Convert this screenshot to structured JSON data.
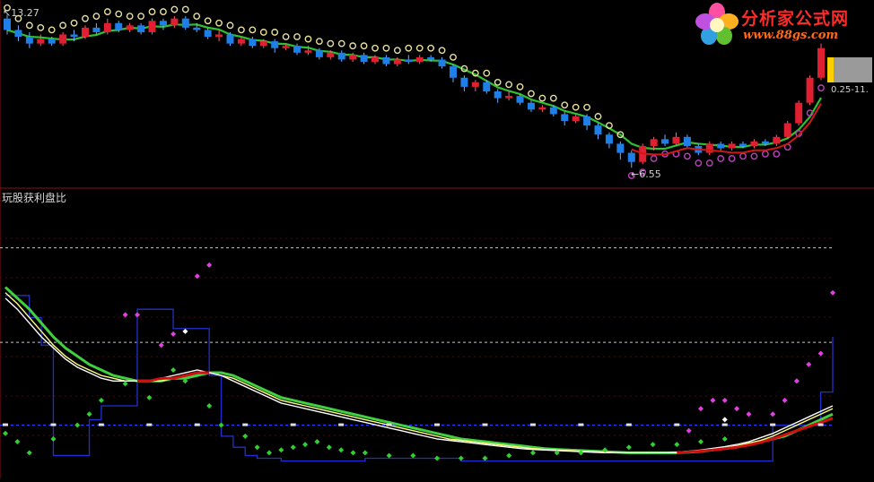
{
  "chart_data": [
    {
      "type": "candlestick",
      "price_high_label": "13.27",
      "price_low_label": "6.55",
      "last_value_label": "0.25-11.",
      "ylim": [
        6.2,
        13.6
      ],
      "candles": [
        [
          13.1,
          12.6,
          13.27,
          12.4
        ],
        [
          12.6,
          12.3,
          12.8,
          12.1
        ],
        [
          12.3,
          12.0,
          12.5,
          11.8
        ],
        [
          12.0,
          12.2,
          12.4,
          11.9
        ],
        [
          12.2,
          12.0,
          12.3,
          11.9
        ],
        [
          12.0,
          12.4,
          12.5,
          11.9
        ],
        [
          12.4,
          12.3,
          12.6,
          12.1
        ],
        [
          12.3,
          12.7,
          12.8,
          12.2
        ],
        [
          12.7,
          12.5,
          12.9,
          12.4
        ],
        [
          12.5,
          12.9,
          13.1,
          12.4
        ],
        [
          12.9,
          12.6,
          13.0,
          12.5
        ],
        [
          12.6,
          12.8,
          12.9,
          12.5
        ],
        [
          12.8,
          12.5,
          12.9,
          12.4
        ],
        [
          12.5,
          13.0,
          13.1,
          12.4
        ],
        [
          13.0,
          12.8,
          13.1,
          12.6
        ],
        [
          12.8,
          13.1,
          13.2,
          12.7
        ],
        [
          13.1,
          12.7,
          13.2,
          12.6
        ],
        [
          12.7,
          12.6,
          12.9,
          12.5
        ],
        [
          12.6,
          12.3,
          12.7,
          12.2
        ],
        [
          12.3,
          12.4,
          12.6,
          12.1
        ],
        [
          12.4,
          12.0,
          12.5,
          11.9
        ],
        [
          12.0,
          12.2,
          12.3,
          11.9
        ],
        [
          12.2,
          11.9,
          12.3,
          11.8
        ],
        [
          11.9,
          12.1,
          12.2,
          11.8
        ],
        [
          12.1,
          11.8,
          12.2,
          11.6
        ],
        [
          11.8,
          11.9,
          12.0,
          11.7
        ],
        [
          11.9,
          11.6,
          12.0,
          11.5
        ],
        [
          11.6,
          11.7,
          11.9,
          11.5
        ],
        [
          11.7,
          11.4,
          11.8,
          11.3
        ],
        [
          11.4,
          11.6,
          11.7,
          11.3
        ],
        [
          11.6,
          11.3,
          11.7,
          11.2
        ],
        [
          11.3,
          11.5,
          11.6,
          11.2
        ],
        [
          11.5,
          11.2,
          11.6,
          11.1
        ],
        [
          11.2,
          11.4,
          11.5,
          11.1
        ],
        [
          11.4,
          11.1,
          11.5,
          11.0
        ],
        [
          11.1,
          11.3,
          11.4,
          11.0
        ],
        [
          11.3,
          11.2,
          11.5,
          11.1
        ],
        [
          11.2,
          11.4,
          11.5,
          11.1
        ],
        [
          11.4,
          11.3,
          11.5,
          11.2
        ],
        [
          11.3,
          11.0,
          11.4,
          10.9
        ],
        [
          11.0,
          10.5,
          11.1,
          10.3
        ],
        [
          10.5,
          10.1,
          10.6,
          9.9
        ],
        [
          10.1,
          10.3,
          10.4,
          9.9
        ],
        [
          10.3,
          9.9,
          10.4,
          9.8
        ],
        [
          9.9,
          9.6,
          10.0,
          9.4
        ],
        [
          9.6,
          9.7,
          9.9,
          9.5
        ],
        [
          9.7,
          9.4,
          9.8,
          9.3
        ],
        [
          9.4,
          9.1,
          9.5,
          9.0
        ],
        [
          9.1,
          9.2,
          9.3,
          9.0
        ],
        [
          9.2,
          8.9,
          9.3,
          8.8
        ],
        [
          8.9,
          8.6,
          9.0,
          8.4
        ],
        [
          8.6,
          8.8,
          8.9,
          8.5
        ],
        [
          8.8,
          8.4,
          8.9,
          8.2
        ],
        [
          8.4,
          8.0,
          8.5,
          7.8
        ],
        [
          8.0,
          7.6,
          8.1,
          7.4
        ],
        [
          7.6,
          7.2,
          7.7,
          6.9
        ],
        [
          7.2,
          6.8,
          7.3,
          6.55
        ],
        [
          6.8,
          7.5,
          7.6,
          6.7
        ],
        [
          7.5,
          7.8,
          7.9,
          7.3
        ],
        [
          7.8,
          7.6,
          8.0,
          7.5
        ],
        [
          7.6,
          7.9,
          8.1,
          7.5
        ],
        [
          7.9,
          7.5,
          8.0,
          7.4
        ],
        [
          7.5,
          7.2,
          7.6,
          7.1
        ],
        [
          7.2,
          7.6,
          7.7,
          7.1
        ],
        [
          7.6,
          7.4,
          7.7,
          7.3
        ],
        [
          7.4,
          7.6,
          7.7,
          7.3
        ],
        [
          7.6,
          7.5,
          7.7,
          7.4
        ],
        [
          7.5,
          7.7,
          7.8,
          7.4
        ],
        [
          7.7,
          7.6,
          7.8,
          7.5
        ],
        [
          7.6,
          7.9,
          8.0,
          7.5
        ],
        [
          7.9,
          8.5,
          8.6,
          7.8
        ],
        [
          8.5,
          9.4,
          9.5,
          8.4
        ],
        [
          9.4,
          10.5,
          10.6,
          9.3
        ],
        [
          10.5,
          11.8,
          12.0,
          10.4
        ]
      ]
    },
    {
      "type": "line",
      "title": "玩股获利盘比",
      "ylim": [
        0,
        100
      ],
      "reference_lines": [
        80,
        48,
        18
      ],
      "series": [
        {
          "color": "#40d040",
          "values": [
            68,
            64,
            60,
            55,
            50,
            46,
            43,
            40,
            38,
            36,
            35,
            34,
            34,
            34,
            35,
            35,
            36,
            37,
            37,
            36,
            34,
            32,
            30,
            28,
            27,
            26,
            25,
            24,
            23,
            22,
            21,
            20,
            19,
            18,
            17,
            16,
            15,
            14,
            13,
            12.5,
            12,
            11.5,
            11,
            10.5,
            10,
            9.5,
            9.2,
            9,
            8.8,
            8.6,
            8.4,
            8.2,
            8,
            8,
            8,
            8,
            8,
            8.2,
            8.5,
            9,
            9.5,
            10,
            11,
            12,
            13,
            14,
            16,
            18,
            20,
            22
          ]
        },
        {
          "color": "#ffff80",
          "values": [
            66,
            62,
            57,
            52,
            47,
            43,
            40,
            38,
            36,
            35,
            34,
            34,
            34,
            34,
            35,
            36,
            37,
            37,
            36,
            35,
            33,
            31,
            29,
            27,
            26,
            25,
            24,
            23,
            22,
            21,
            20,
            19,
            18,
            17,
            16,
            15,
            14,
            13,
            12.5,
            12,
            11.5,
            11,
            10.5,
            10,
            9.5,
            9.2,
            9,
            8.8,
            8.6,
            8.4,
            8.2,
            8,
            8,
            8,
            8,
            8,
            8,
            8.3,
            8.7,
            9.2,
            9.8,
            10.5,
            11.5,
            12.5,
            14,
            16,
            18,
            20,
            22,
            24
          ]
        },
        {
          "color": "#ffffff",
          "values": [
            64,
            60,
            55,
            50,
            46,
            42,
            39,
            37,
            35,
            34,
            34,
            34,
            34,
            35,
            36,
            37,
            38,
            37,
            36,
            34,
            32,
            30,
            28,
            26,
            25,
            24,
            23,
            22,
            21,
            20,
            19,
            18,
            17,
            16,
            15,
            14,
            13,
            12.5,
            12,
            11.5,
            11,
            10.5,
            10,
            9.5,
            9.2,
            9,
            8.8,
            8.6,
            8.4,
            8.2,
            8,
            8,
            8,
            8,
            8,
            8,
            8.2,
            8.6,
            9,
            9.6,
            10.2,
            11,
            12,
            13.5,
            15,
            17,
            19,
            21,
            23,
            25
          ]
        },
        {
          "color": "#d01010",
          "values": [
            null,
            null,
            null,
            null,
            null,
            null,
            null,
            null,
            null,
            null,
            null,
            34,
            34,
            35,
            35,
            36,
            37,
            37,
            null,
            null,
            null,
            null,
            null,
            null,
            null,
            null,
            null,
            null,
            null,
            null,
            null,
            null,
            null,
            null,
            null,
            null,
            null,
            null,
            null,
            null,
            null,
            null,
            null,
            null,
            null,
            null,
            null,
            null,
            null,
            null,
            null,
            null,
            null,
            null,
            null,
            null,
            8,
            8.3,
            8.6,
            9,
            9.5,
            10,
            10.8,
            11.8,
            13,
            14.5,
            16,
            17.5,
            19,
            20.5
          ]
        }
      ],
      "step_line": {
        "color": "#2030d0",
        "values": [
          65,
          65,
          57,
          47,
          7,
          7,
          7,
          20,
          25,
          25,
          25,
          60,
          60,
          60,
          53,
          53,
          53,
          36,
          14,
          10,
          7,
          6,
          6,
          5,
          5,
          5,
          5,
          5,
          5,
          5,
          6,
          6,
          6,
          6,
          6,
          6,
          6,
          6,
          5,
          5,
          5,
          5,
          5,
          5,
          5,
          5,
          5,
          5,
          5,
          5,
          5,
          5,
          5,
          5,
          5,
          5,
          5,
          5,
          5,
          5,
          5,
          5,
          5,
          5,
          18,
          18,
          18,
          18,
          30,
          50
        ]
      },
      "dots_green": [
        [
          0,
          15
        ],
        [
          1,
          12
        ],
        [
          2,
          8
        ],
        [
          4,
          13
        ],
        [
          6,
          18
        ],
        [
          7,
          22
        ],
        [
          8,
          27
        ],
        [
          10,
          33
        ],
        [
          12,
          28
        ],
        [
          14,
          38
        ],
        [
          15,
          34
        ],
        [
          17,
          25
        ],
        [
          18,
          18
        ],
        [
          20,
          14
        ],
        [
          21,
          10
        ],
        [
          22,
          8
        ],
        [
          23,
          9
        ],
        [
          24,
          10
        ],
        [
          25,
          11
        ],
        [
          26,
          12
        ],
        [
          27,
          10
        ],
        [
          28,
          9
        ],
        [
          29,
          8
        ],
        [
          30,
          8
        ],
        [
          32,
          7
        ],
        [
          34,
          7
        ],
        [
          36,
          6
        ],
        [
          38,
          6
        ],
        [
          40,
          6
        ],
        [
          42,
          7
        ],
        [
          44,
          8
        ],
        [
          46,
          8
        ],
        [
          48,
          8
        ],
        [
          50,
          9
        ],
        [
          52,
          10
        ],
        [
          54,
          11
        ],
        [
          56,
          11
        ],
        [
          58,
          12
        ],
        [
          60,
          13
        ]
      ],
      "dots_magenta": [
        [
          13,
          47
        ],
        [
          14,
          51
        ],
        [
          16,
          72
        ],
        [
          17,
          76
        ],
        [
          10,
          58
        ],
        [
          11,
          58
        ],
        [
          57,
          16
        ],
        [
          58,
          24
        ],
        [
          59,
          27
        ],
        [
          60,
          27
        ],
        [
          61,
          24
        ],
        [
          62,
          22
        ],
        [
          64,
          22
        ],
        [
          65,
          27
        ],
        [
          66,
          34
        ],
        [
          67,
          40
        ],
        [
          68,
          44
        ],
        [
          69,
          66
        ]
      ],
      "dots_white": [
        [
          15,
          52
        ],
        [
          60,
          20
        ]
      ]
    }
  ]
}
